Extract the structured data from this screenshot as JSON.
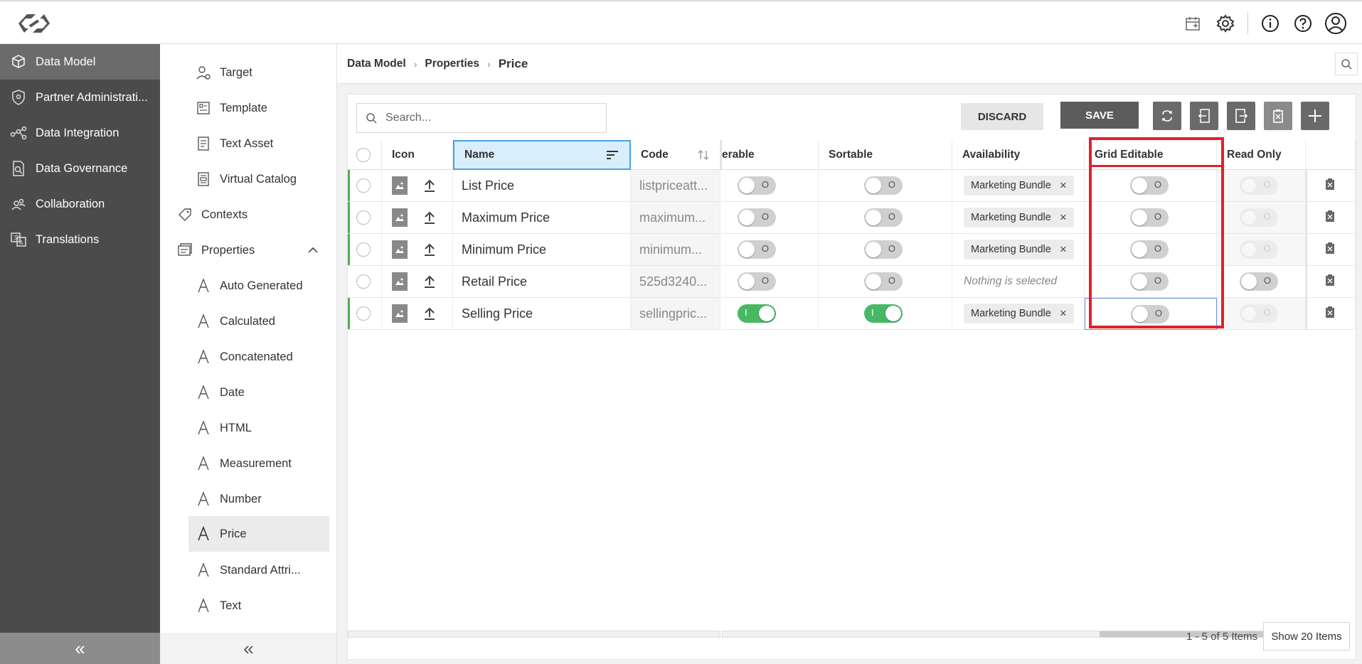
{
  "topbar": {
    "icons": [
      "calendar-icon",
      "gear-icon",
      "info-icon",
      "help-icon",
      "user-icon"
    ]
  },
  "leftnav": {
    "items": [
      {
        "label": "Data Model",
        "icon": "data-model-icon",
        "active": true
      },
      {
        "label": "Partner Administrati...",
        "icon": "shield-icon",
        "active": false
      },
      {
        "label": "Data Integration",
        "icon": "integration-icon",
        "active": false
      },
      {
        "label": "Data Governance",
        "icon": "governance-icon",
        "active": false
      },
      {
        "label": "Collaboration",
        "icon": "collaboration-icon",
        "active": false
      },
      {
        "label": "Translations",
        "icon": "translations-icon",
        "active": false
      }
    ],
    "collapse_label": "«"
  },
  "subnav": {
    "items": [
      {
        "label": "Target",
        "icon": "target-icon"
      },
      {
        "label": "Template",
        "icon": "template-icon"
      },
      {
        "label": "Text Asset",
        "icon": "text-asset-icon"
      },
      {
        "label": "Virtual Catalog",
        "icon": "virtual-catalog-icon"
      },
      {
        "label": "Contexts",
        "icon": "tag-icon"
      },
      {
        "label": "Properties",
        "icon": "properties-icon"
      },
      {
        "label": "Auto Generated",
        "icon": "attribute-icon"
      },
      {
        "label": "Calculated",
        "icon": "attribute-icon"
      },
      {
        "label": "Concatenated",
        "icon": "attribute-icon"
      },
      {
        "label": "Date",
        "icon": "attribute-icon"
      },
      {
        "label": "HTML",
        "icon": "attribute-icon"
      },
      {
        "label": "Measurement",
        "icon": "attribute-icon"
      },
      {
        "label": "Number",
        "icon": "attribute-icon"
      },
      {
        "label": "Price",
        "icon": "attribute-icon"
      },
      {
        "label": "Standard Attri...",
        "icon": "attribute-icon"
      },
      {
        "label": "Text",
        "icon": "attribute-icon"
      }
    ],
    "selected": "Price",
    "collapse_label": "«"
  },
  "breadcrumb": {
    "items": [
      "Data Model",
      "Properties"
    ],
    "current": "Price",
    "separator": "›"
  },
  "toolbar": {
    "search_placeholder": "Search...",
    "discard_label": "DISCARD",
    "save_label": "SAVE"
  },
  "grid": {
    "columns": {
      "icon": "Icon",
      "name": "Name",
      "code": "Code",
      "filterable": "erable",
      "sortable": "Sortable",
      "availability": "Availability",
      "grid_editable": "Grid Editable",
      "read_only": "Read Only"
    },
    "rows": [
      {
        "name": "List Price",
        "code": "listpriceatt...",
        "filterable": false,
        "sortable": false,
        "availability": "Marketing Bundle",
        "grid_editable": false,
        "read_only": false,
        "read_only_disabled": true,
        "modified": true
      },
      {
        "name": "Maximum Price",
        "code": "maximum...",
        "filterable": false,
        "sortable": false,
        "availability": "Marketing Bundle",
        "grid_editable": false,
        "read_only": false,
        "read_only_disabled": true,
        "modified": true
      },
      {
        "name": "Minimum Price",
        "code": "minimum...",
        "filterable": false,
        "sortable": false,
        "availability": "Marketing Bundle",
        "grid_editable": false,
        "read_only": false,
        "read_only_disabled": true,
        "modified": true
      },
      {
        "name": "Retail Price",
        "code": "525d3240...",
        "filterable": false,
        "sortable": false,
        "availability": "",
        "grid_editable": false,
        "read_only": false,
        "read_only_disabled": false,
        "modified": false
      },
      {
        "name": "Selling Price",
        "code": "sellingpric...",
        "filterable": true,
        "sortable": true,
        "availability": "Marketing Bundle",
        "grid_editable": false,
        "read_only": false,
        "read_only_disabled": true,
        "modified": true
      }
    ],
    "nothing_selected": "Nothing is selected",
    "toggle_on_text": "I",
    "toggle_off_text": "O",
    "chip_remove": "×"
  },
  "footer": {
    "count": "1 - 5 of 5 Items",
    "show_label": "Show 20 Items"
  },
  "colors": {
    "accent_green": "#48b865",
    "highlight_red": "#e0202a",
    "nav_dark": "#4b4b4b"
  }
}
